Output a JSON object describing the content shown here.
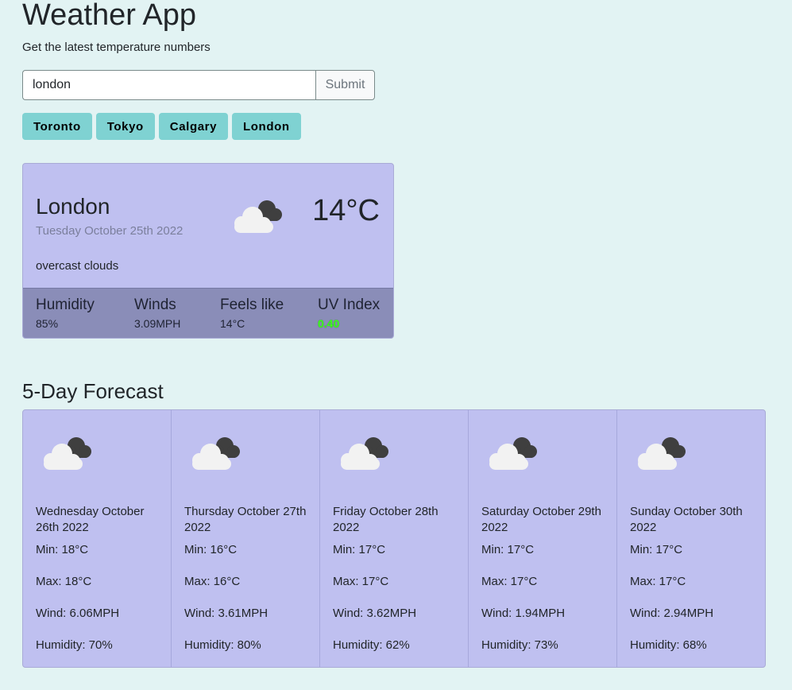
{
  "header": {
    "title": "Weather App",
    "subtitle": "Get the latest temperature numbers"
  },
  "search": {
    "value": "london",
    "submit_label": "Submit"
  },
  "cities": [
    "Toronto",
    "Tokyo",
    "Calgary",
    "London"
  ],
  "current": {
    "city": "London",
    "date": "Tuesday October 25th 2022",
    "temp": "14°C",
    "description": "overcast clouds",
    "icon": "overcast-clouds-icon",
    "stats": {
      "humidity_label": "Humidity",
      "humidity": "85%",
      "winds_label": "Winds",
      "winds": "3.09MPH",
      "feels_label": "Feels like",
      "feels": "14°C",
      "uv_label": "UV Index",
      "uv": "0.40"
    },
    "colors": {
      "uv_good": "#3dff1f",
      "card": "#bfc0f0",
      "stats_bar": "#8a8db8"
    }
  },
  "forecast": {
    "title": "5-Day Forecast",
    "days": [
      {
        "date": "Wednesday October 26th 2022",
        "min": "Min: 18°C",
        "max": "Max: 18°C",
        "wind": "Wind: 6.06MPH",
        "humidity": "Humidity: 70%",
        "icon": "overcast-clouds-icon"
      },
      {
        "date": "Thursday October 27th 2022",
        "min": "Min: 16°C",
        "max": "Max: 16°C",
        "wind": "Wind: 3.61MPH",
        "humidity": "Humidity: 80%",
        "icon": "overcast-clouds-icon"
      },
      {
        "date": "Friday October 28th 2022",
        "min": "Min: 17°C",
        "max": "Max: 17°C",
        "wind": "Wind: 3.62MPH",
        "humidity": "Humidity: 62%",
        "icon": "overcast-clouds-icon"
      },
      {
        "date": "Saturday October 29th 2022",
        "min": "Min: 17°C",
        "max": "Max: 17°C",
        "wind": "Wind: 1.94MPH",
        "humidity": "Humidity: 73%",
        "icon": "overcast-clouds-icon"
      },
      {
        "date": "Sunday October 30th 2022",
        "min": "Min: 17°C",
        "max": "Max: 17°C",
        "wind": "Wind: 2.94MPH",
        "humidity": "Humidity: 68%",
        "icon": "overcast-clouds-icon"
      }
    ]
  },
  "colors": {
    "background": "#e2f3f3",
    "city_button": "#7fd2d2"
  }
}
